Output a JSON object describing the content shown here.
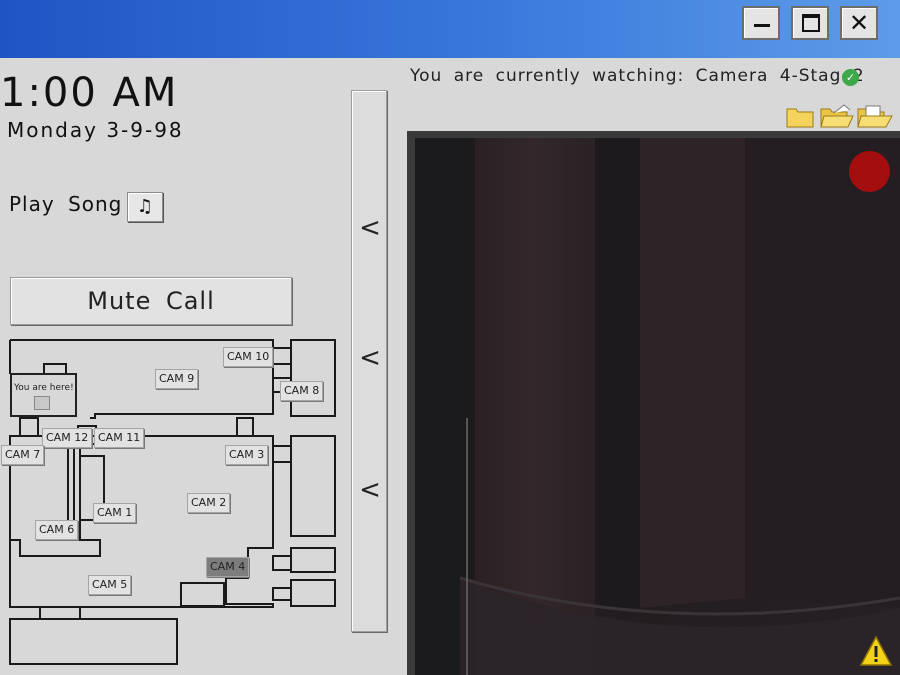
{
  "window": {
    "controls": {
      "minimize_icon": "minimize-icon",
      "maximize_icon": "maximize-icon",
      "close_glyph": "✕"
    }
  },
  "status": {
    "time": "1:00 AM",
    "date": "Monday 3-9-98"
  },
  "controls": {
    "play_song_label": "Play Song",
    "song_icon": "♫",
    "mute_call_label": "Mute Call"
  },
  "map": {
    "you_are_here": "You are here!",
    "cameras": [
      {
        "id": "cam10",
        "label": "CAM 10"
      },
      {
        "id": "cam9",
        "label": "CAM 9"
      },
      {
        "id": "cam8",
        "label": "CAM 8"
      },
      {
        "id": "cam12",
        "label": "CAM 12"
      },
      {
        "id": "cam11",
        "label": "CAM 11"
      },
      {
        "id": "cam7",
        "label": "CAM 7"
      },
      {
        "id": "cam3",
        "label": "CAM 3"
      },
      {
        "id": "cam2",
        "label": "CAM 2"
      },
      {
        "id": "cam1",
        "label": "CAM 1"
      },
      {
        "id": "cam6",
        "label": "CAM 6"
      },
      {
        "id": "cam4",
        "label": "CAM 4",
        "active": true
      },
      {
        "id": "cam5",
        "label": "CAM 5"
      }
    ]
  },
  "side_panel": {
    "chevrons": [
      "<",
      "<",
      "<"
    ]
  },
  "camera": {
    "watching_text": "You are currently watching: Camera 4-Stage2",
    "status_icon": "check-circle-icon",
    "status_color": "#3ca84a",
    "recording_color": "#a50e0e",
    "warning_icon": "warning-icon"
  }
}
